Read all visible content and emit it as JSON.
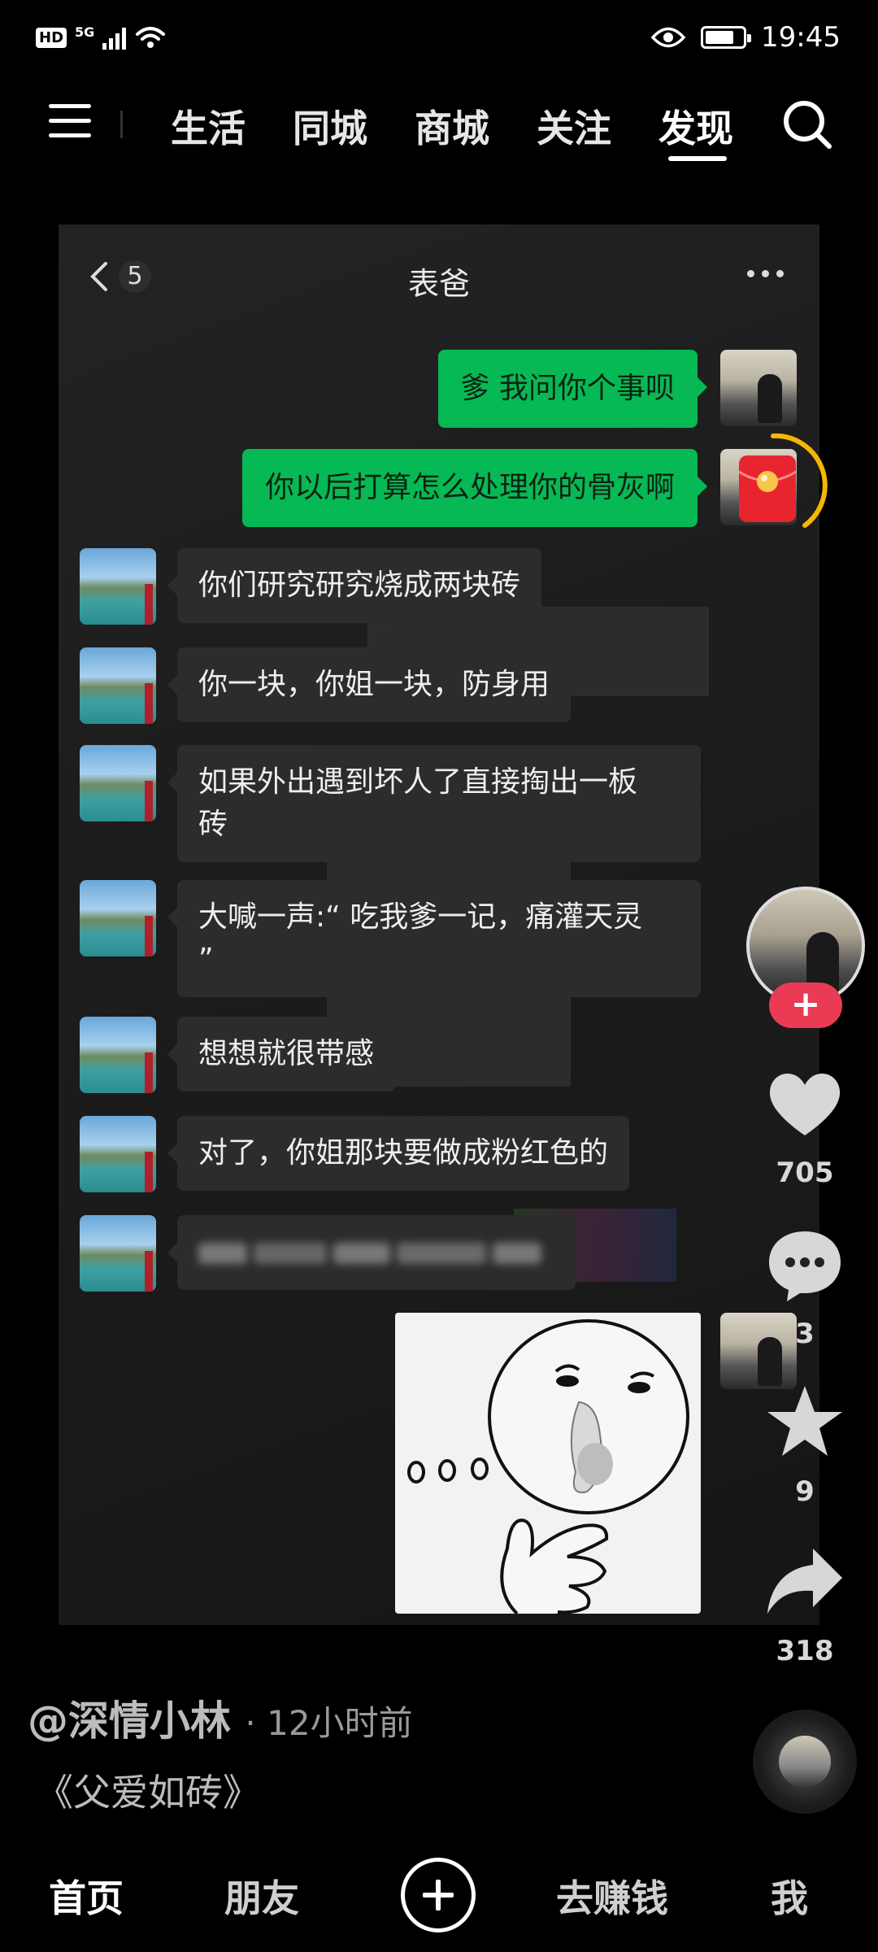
{
  "status_bar": {
    "hd": "HD",
    "network": "5G",
    "time": "19:45"
  },
  "top_nav": {
    "tabs": [
      "生活",
      "同城",
      "商城",
      "关注",
      "发现"
    ],
    "active_tab": "发现"
  },
  "chat": {
    "back_count": "5",
    "title": "表爸",
    "messages": [
      {
        "side": "right",
        "text": "爹 我问你个事呗"
      },
      {
        "side": "right",
        "text": "你以后打算怎么处理你的骨灰啊"
      },
      {
        "side": "left",
        "text": "你们研究研究烧成两块砖"
      },
      {
        "side": "left",
        "text": "你一块，你姐一块，防身用"
      },
      {
        "side": "left",
        "line1": "如果外出遇到坏人了直接掏出一板",
        "line2": "砖"
      },
      {
        "side": "left",
        "line1": "大喊一声:“ 吃我爹一记，痛灌天灵",
        "line2": "”"
      },
      {
        "side": "left",
        "text": "想想就很带感"
      },
      {
        "side": "left",
        "text": "对了，你姐那块要做成粉红色的"
      },
      {
        "side": "left",
        "text": ""
      },
      {
        "side": "right",
        "type": "sticker"
      }
    ]
  },
  "actions": {
    "likes": "705",
    "comments": "3",
    "favorites": "9",
    "shares": "318",
    "follow_symbol": "+"
  },
  "post": {
    "author": "@深情小林",
    "time": "· 12小时前",
    "caption": "《父爱如砖》"
  },
  "bottom_nav": {
    "items": [
      "首页",
      "朋友",
      "去赚钱",
      "我"
    ],
    "active": "首页"
  },
  "colors": {
    "accent_green": "#07b954",
    "follow_red": "#ea3a54",
    "red_envelope": "#e8252f",
    "ring_yellow": "#f5b800"
  },
  "icons": [
    "menu-icon",
    "search-icon",
    "back-chevron-icon",
    "more-icon",
    "red-envelope-icon",
    "heart-icon",
    "comment-icon",
    "star-icon",
    "share-icon",
    "music-disc-icon",
    "add-icon"
  ]
}
